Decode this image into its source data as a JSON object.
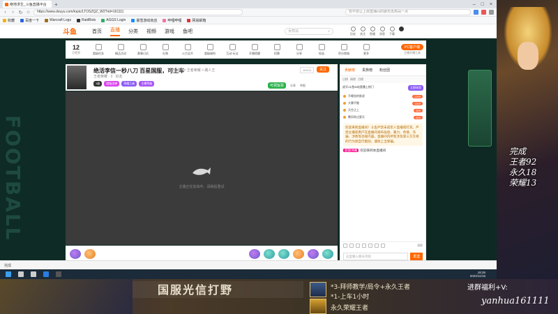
{
  "browser": {
    "tab_title": "绝地求生_斗鱼直播平台",
    "url": "https://www.douyu.com/topic/LTOSZQZ_W2?rid=161111",
    "search_placeholder": "想不想让上岸直播间的聊天再热闹一点",
    "bookmarks": [
      "收藏",
      "百度一下",
      "Warcraft Logs",
      "RaidBots",
      "AGGS Login",
      "暴雪游戏商店",
      "哔哩哔哩",
      "网易邮箱"
    ]
  },
  "site": {
    "logo": "斗鱼",
    "nav": [
      "首页",
      "直播",
      "分类",
      "视频",
      "游戏",
      "鱼吧"
    ],
    "active_nav": "直播",
    "search_placeholder": "大司马",
    "header_icons": [
      "历史",
      "关注",
      "鱼塘",
      "消息",
      "下载"
    ]
  },
  "activity": {
    "date": "12",
    "date_label": "月签到",
    "items": [
      "超级任务",
      "精品活动",
      "赛事日历",
      "礼物",
      "火力全开",
      "超级福利",
      "互动·玩法",
      "开播提醒",
      "招募",
      "分享",
      "权益",
      "积分商城",
      "更多"
    ],
    "pc_button": "PC客户端",
    "pc_sub": "主播开播工具"
  },
  "stream": {
    "title": "绝活李信一秒八刀 百星国服，可上车",
    "breadcrumb": "全部分类 > 王者荣耀 > 路人王",
    "meta": "王者荣耀 · 3 · 好友",
    "room_id": "161111",
    "follow_label": "关注",
    "badges": [
      "1级",
      "国服战神",
      "荣耀王者",
      "主播等级"
    ],
    "daily_label": "可领饭票",
    "share_label": "分享",
    "report_label": "举报",
    "video_note": "主播正在加油中，请稍后重试"
  },
  "sidebar": {
    "tabs": [
      "贡献榜",
      "贵族榜",
      "粉丝团"
    ],
    "sub_tabs": [
      "日榜",
      "周榜",
      "月榜"
    ],
    "promo_text": "虎牙/斗鱼/B站直播上热门",
    "promo_button": "立即体验",
    "ranks": [
      {
        "name": "不睡觉的胖虎",
        "pill": "1200"
      },
      {
        "name": "大雾不散",
        "pill": "1100"
      },
      {
        "name": "天空之上",
        "pill": "800"
      },
      {
        "name": "晚风吹过夏天",
        "pill": "600"
      }
    ],
    "notice": "欢迎来到直播间！斗鱼严禁未成年人直播或打赏。严禁主播或用户在直播间发布低俗、暴力、色情、诈骗、涉政等违规内容。直播间内所有涉及第三方交易的行为请自行甄别，谨防上当受骗。",
    "chat_tag": "超级弹幕",
    "chat_text": "欢迎来到本直播间",
    "clear_chat": "清屏",
    "input_placeholder": "这里输入聊天内容",
    "send_label": "发送"
  },
  "side_text": "FOOTBALL",
  "status_bar": "完成",
  "taskbar": {
    "time": "18:26",
    "date": "2022/11/16"
  },
  "overlay": {
    "score_lines": [
      "完成",
      "王者92",
      "永久18",
      "荣耀13"
    ],
    "banner": "国服光信打野",
    "lines": [
      "*3-拜师教学/局令+永久王者",
      "*1-上车1小时",
      "永久荣耀王者"
    ],
    "benefits": "进群福利+V:",
    "handle": "yanhua161111"
  }
}
